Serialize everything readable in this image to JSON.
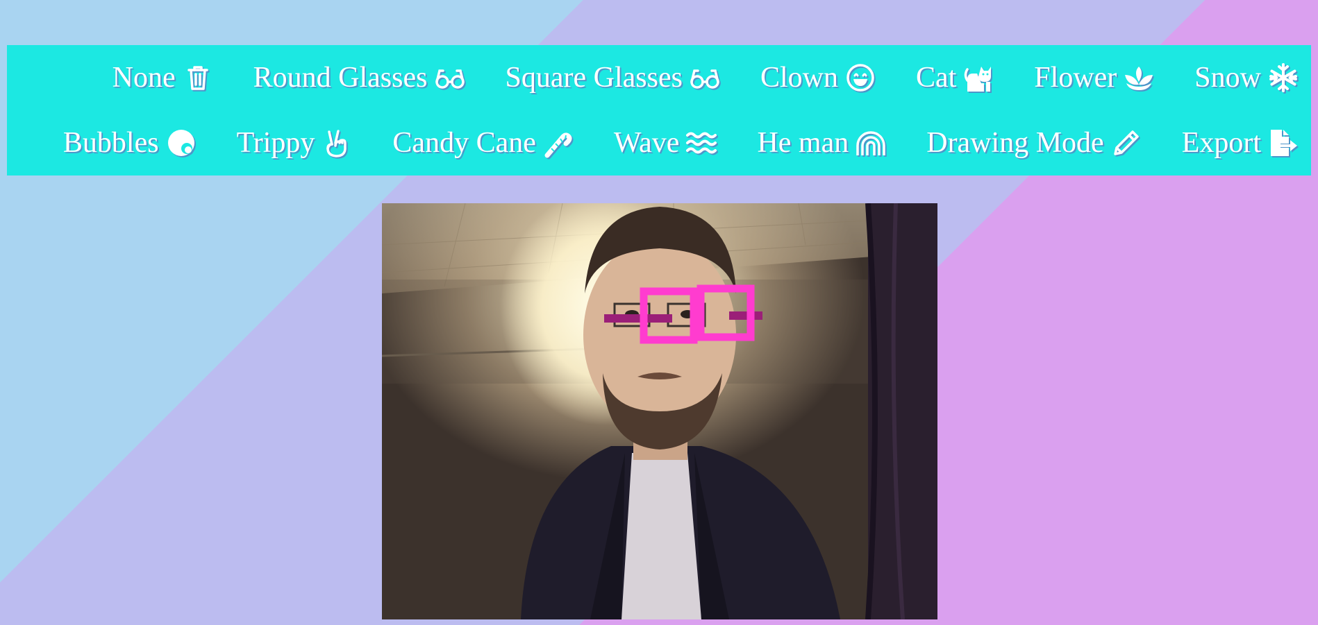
{
  "toolbar": {
    "row1": [
      {
        "label": "None",
        "icon": "trash-icon"
      },
      {
        "label": "Round Glasses",
        "icon": "glasses-icon"
      },
      {
        "label": "Square Glasses",
        "icon": "glasses-icon"
      },
      {
        "label": "Clown",
        "icon": "smile-icon"
      },
      {
        "label": "Cat",
        "icon": "cat-icon"
      },
      {
        "label": "Flower",
        "icon": "lotus-icon"
      },
      {
        "label": "Snow",
        "icon": "snowflake-icon"
      }
    ],
    "row2": [
      {
        "label": "Bubbles",
        "icon": "bubble-icon"
      },
      {
        "label": "Trippy",
        "icon": "peace-hand-icon"
      },
      {
        "label": "Candy Cane",
        "icon": "candy-cane-icon"
      },
      {
        "label": "Wave",
        "icon": "water-icon"
      },
      {
        "label": "He man",
        "icon": "rainbow-icon"
      },
      {
        "label": "Drawing Mode",
        "icon": "pencil-icon"
      },
      {
        "label": "Export",
        "icon": "file-export-icon"
      }
    ]
  },
  "video": {
    "active_filter": "Square Glasses",
    "overlay_color": "#ff3ccf",
    "temple_color": "#9b1f78"
  },
  "colors": {
    "toolbar_bg": "#1ce8e2",
    "bg_blue": "#a9d4f1",
    "bg_lavender": "#bcbcf0",
    "bg_pink": "#daa0ef"
  }
}
